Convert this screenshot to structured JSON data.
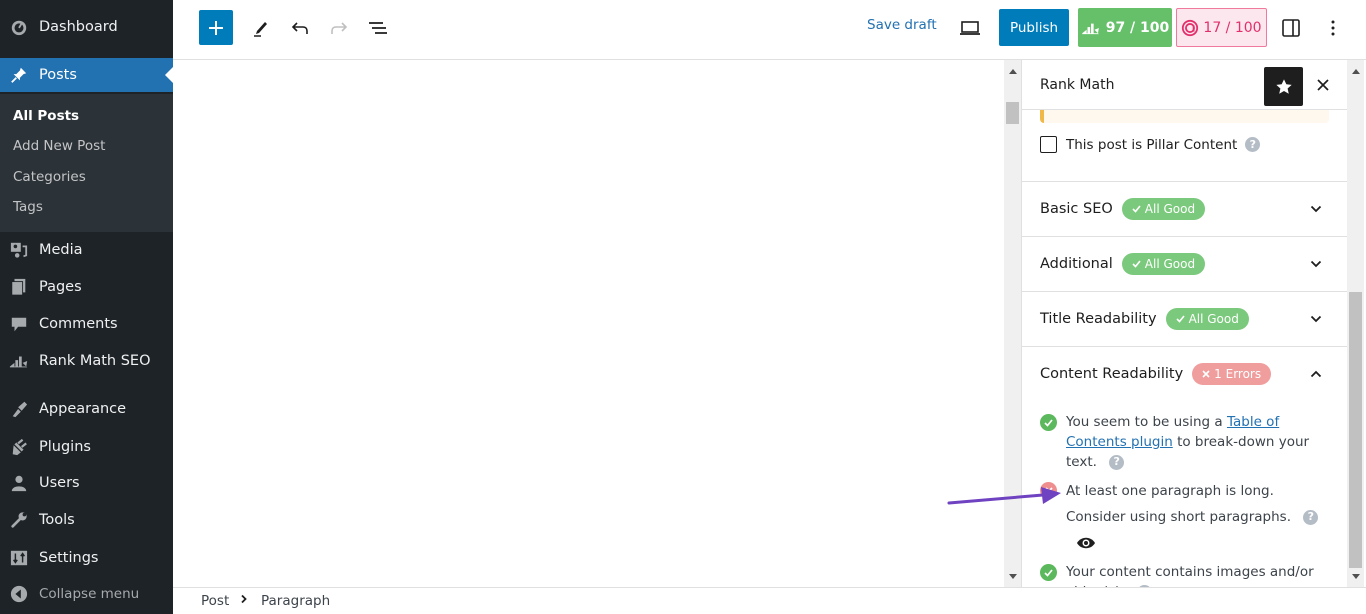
{
  "admin_menu": {
    "items": [
      {
        "label": "Dashboard",
        "icon": "dashboard-icon"
      },
      {
        "label": "Posts",
        "icon": "pin-icon",
        "active": true
      },
      {
        "label": "Media",
        "icon": "media-icon"
      },
      {
        "label": "Pages",
        "icon": "pages-icon"
      },
      {
        "label": "Comments",
        "icon": "comments-icon"
      },
      {
        "label": "Rank Math SEO",
        "icon": "rank-math-icon"
      },
      {
        "label": "Appearance",
        "icon": "appearance-icon"
      },
      {
        "label": "Plugins",
        "icon": "plugins-icon"
      },
      {
        "label": "Users",
        "icon": "users-icon"
      },
      {
        "label": "Tools",
        "icon": "tools-icon"
      },
      {
        "label": "Settings",
        "icon": "settings-icon"
      }
    ],
    "submenu": [
      "All Posts",
      "Add New Post",
      "Categories",
      "Tags"
    ],
    "current_sub": "All Posts",
    "collapse_label": "Collapse menu"
  },
  "toolbar": {
    "save_draft": "Save draft",
    "publish": "Publish",
    "seo_score": "97 / 100",
    "ai_score": "17 / 100"
  },
  "sidebar": {
    "title": "Rank Math",
    "pillar_label": "This post is Pillar Content",
    "pillar_checked": false,
    "sections": [
      {
        "title": "Basic SEO",
        "badge": "All Good",
        "status": "good",
        "expanded": false
      },
      {
        "title": "Additional",
        "badge": "All Good",
        "status": "good",
        "expanded": false
      },
      {
        "title": "Title Readability",
        "badge": "All Good",
        "status": "good",
        "expanded": false
      },
      {
        "title": "Content Readability",
        "badge": "1 Errors",
        "status": "error",
        "expanded": true
      }
    ],
    "checks": [
      {
        "status": "ok",
        "pre": "You seem to be using a ",
        "link": "Table of Contents plugin",
        "post": " to break-down your text."
      },
      {
        "status": "fail",
        "text": "At least one paragraph is long. Consider using short paragraphs."
      },
      {
        "status": "ok",
        "text": "Your content contains images and/or video(s)."
      }
    ]
  },
  "footer": {
    "breadcrumb": [
      "Post",
      "Paragraph"
    ]
  },
  "colors": {
    "wp_blue": "#007cba",
    "admin_bg": "#1d2327",
    "seo_green": "#66c06a",
    "ai_pink": "#e1306c",
    "error_red": "#f09d9d",
    "annotation_arrow": "#6f42c1"
  }
}
